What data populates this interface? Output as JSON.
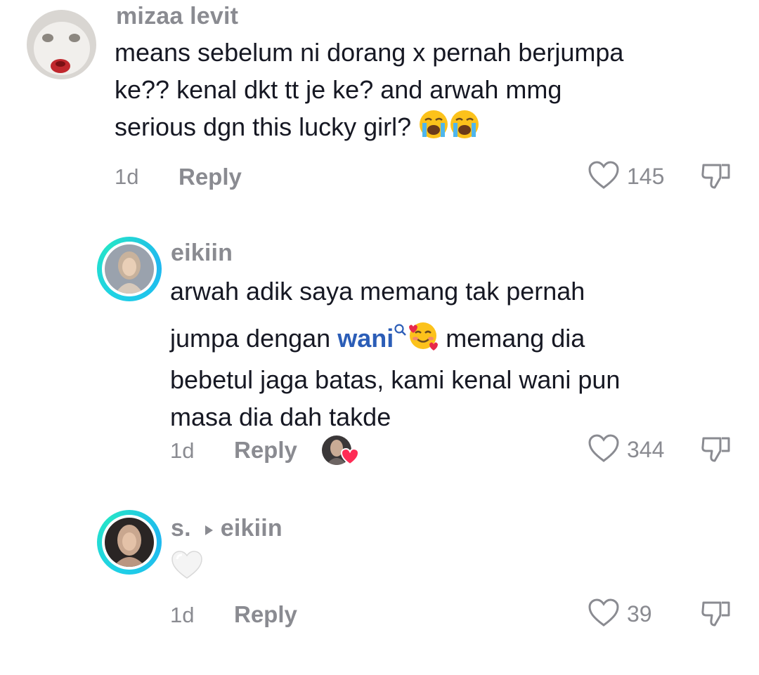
{
  "comments": [
    {
      "username": "mizaa levit",
      "lines": [
        "means sebelum ni dorang x pernah berjumpa",
        "ke?? kenal dkt tt je ke? and arwah mmg",
        "serious dgn this lucky girl?"
      ],
      "time": "1d",
      "reply_label": "Reply",
      "likes": "145",
      "emoji": [
        "loudly-crying-face",
        "loudly-crying-face"
      ]
    },
    {
      "username": "eikiin",
      "line1": "arwah adik saya memang tak pernah",
      "line2_before": "jumpa dengan ",
      "mention": "wani",
      "line2_after": " memang dia",
      "line3": "bebetul jaga batas, kami kenal wani pun",
      "line4": "masa dia dah takde",
      "time": "1d",
      "reply_label": "Reply",
      "likes": "344",
      "emoji": [
        "smiling-face-with-hearts"
      ]
    },
    {
      "username": "s.",
      "reply_to": "eikiin",
      "time": "1d",
      "reply_label": "Reply",
      "likes": "39",
      "emoji": [
        "white-heart"
      ]
    }
  ]
}
